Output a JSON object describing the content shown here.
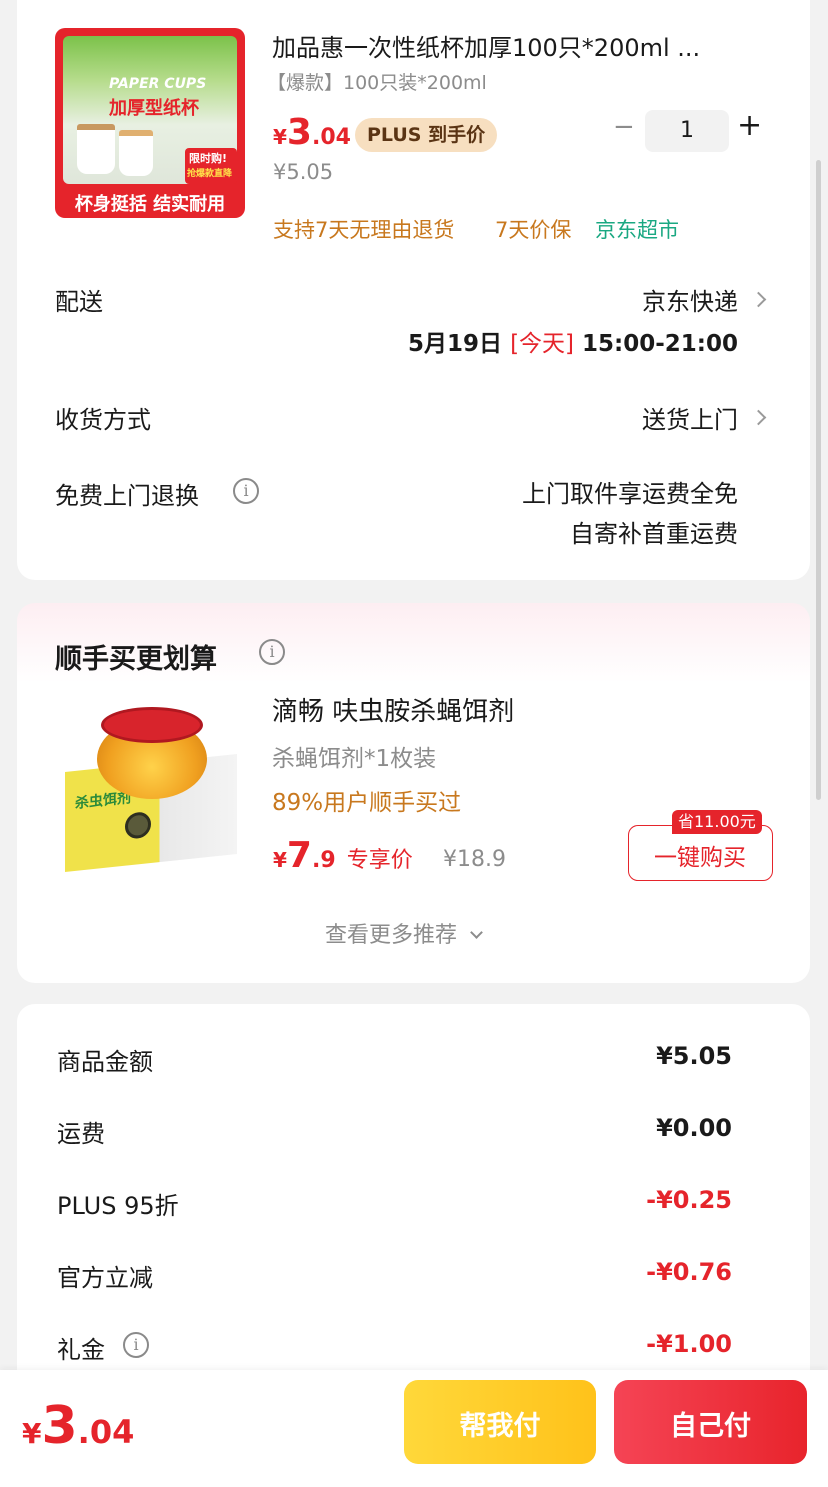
{
  "product": {
    "image_label": "杯身挺括 结实耐用",
    "image_banner": "PAPER CUPS",
    "image_title": "加厚型纸杯",
    "image_badge": "限时购!",
    "image_badge2": "抢爆款直降",
    "title": "加品惠一次性纸杯加厚100只*200ml ...",
    "spec": "【爆款】100只装*200ml",
    "price_symbol": "¥",
    "price_int": "3",
    "price_dec": ".04",
    "plus_label": "PLUS 到手价",
    "orig_price": "¥5.05",
    "qty": "1",
    "minus": "−",
    "plus": "+",
    "tag_return": "支持7天无理由退货",
    "tag_price": "7天价保",
    "tag_store": "京东超市"
  },
  "delivery": {
    "label": "配送",
    "carrier": "京东快递",
    "date": "5月19日",
    "today": "[今天]",
    "time": "15:00-21:00"
  },
  "receive": {
    "label": "收货方式",
    "value": "送货上门"
  },
  "returns": {
    "label": "免费上门退换",
    "line1": "上门取件享运费全免",
    "line2": "自寄补首重运费"
  },
  "recommend": {
    "title": "顺手买更划算",
    "item_title": "滴畅 呋虫胺杀蝇饵剂",
    "item_spec": "杀蝇饵剂*1枚装",
    "item_stat": "89%用户顺手买过",
    "price_symbol": "¥",
    "price_int": "7",
    "price_dec": ".9",
    "price_tag": "专享价",
    "orig_price": "¥18.9",
    "save_badge": "省11.00元",
    "buy_button": "一键购买",
    "more": "查看更多推荐",
    "box_label": "杀虫饵剂"
  },
  "summary": {
    "rows": [
      {
        "label": "商品金额",
        "value": "¥5.05"
      },
      {
        "label": "运费",
        "value": "¥0.00"
      },
      {
        "label": "PLUS 95折",
        "value": "-¥0.25"
      },
      {
        "label": "官方立减",
        "value": "-¥0.76"
      },
      {
        "label": "礼金",
        "value": "-¥1.00"
      }
    ]
  },
  "footer": {
    "price_symbol": "¥",
    "price_int": "3",
    "price_dec": ".04",
    "help_pay": "帮我付",
    "self_pay": "自己付"
  },
  "colors": {
    "accent_red": "#e5242b",
    "tag_orange": "#c8781e",
    "store_green": "#1aa882",
    "plus_gold": "#f7dfc0"
  }
}
